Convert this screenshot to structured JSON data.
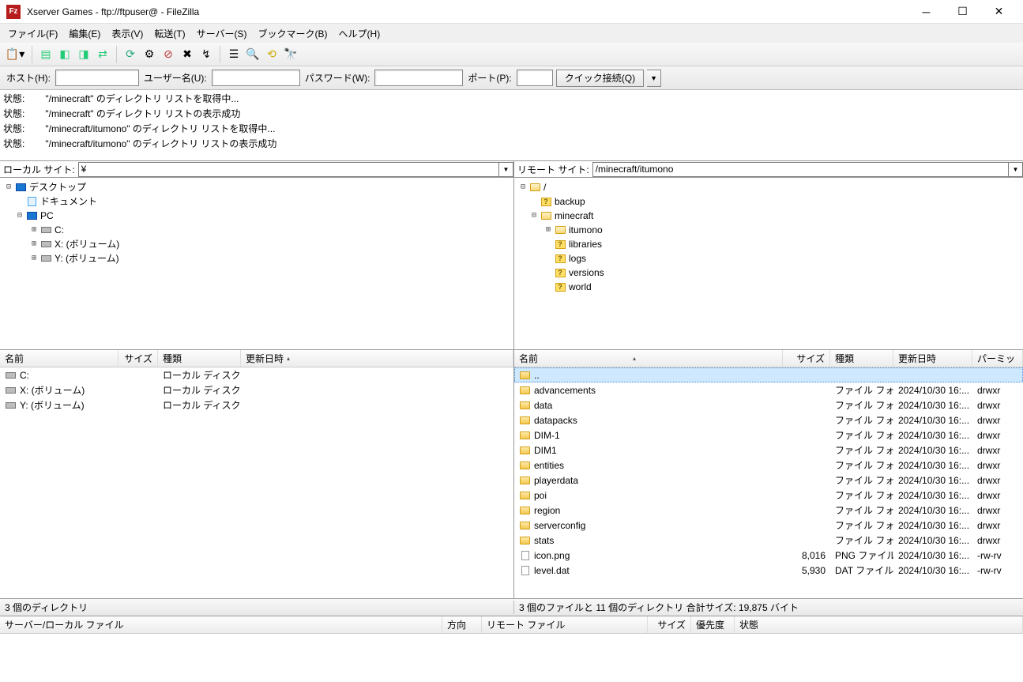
{
  "title": "Xserver Games - ftp://ftpuser@                        - FileZilla",
  "menus": {
    "file": "ファイル(F)",
    "edit": "編集(E)",
    "view": "表示(V)",
    "transfer": "転送(T)",
    "server": "サーバー(S)",
    "bookmarks": "ブックマーク(B)",
    "help": "ヘルプ(H)"
  },
  "quickbar": {
    "host_lbl": "ホスト(H):",
    "user_lbl": "ユーザー名(U):",
    "pass_lbl": "パスワード(W):",
    "port_lbl": "ポート(P):",
    "connect": "クイック接続(Q)"
  },
  "log": [
    {
      "label": "状態:",
      "text": "\"/minecraft\" のディレクトリ リストを取得中..."
    },
    {
      "label": "状態:",
      "text": "\"/minecraft\" のディレクトリ リストの表示成功"
    },
    {
      "label": "状態:",
      "text": "\"/minecraft/itumono\" のディレクトリ リストを取得中..."
    },
    {
      "label": "状態:",
      "text": "\"/minecraft/itumono\" のディレクトリ リストの表示成功"
    }
  ],
  "local_site_lbl": "ローカル サイト:",
  "local_site_val": "¥",
  "remote_site_lbl": "リモート サイト:",
  "remote_site_val": "/minecraft/itumono",
  "local_tree": {
    "desktop": "デスクトップ",
    "documents": "ドキュメント",
    "pc": "PC",
    "c": "C:",
    "x": "X: (ボリューム)",
    "y": "Y: (ボリューム)"
  },
  "remote_tree": {
    "root": "/",
    "backup": "backup",
    "minecraft": "minecraft",
    "itumono": "itumono",
    "libraries": "libraries",
    "logs": "logs",
    "versions": "versions",
    "world": "world"
  },
  "list_cols": {
    "name": "名前",
    "size": "サイズ",
    "type": "種類",
    "date": "更新日時",
    "perm": "パーミッ"
  },
  "local_list": [
    {
      "name": "C:",
      "type": "ローカル ディスク"
    },
    {
      "name": "X: (ボリューム)",
      "type": "ローカル ディスク"
    },
    {
      "name": "Y: (ボリューム)",
      "type": "ローカル ディスク"
    }
  ],
  "remote_list": [
    {
      "name": "..",
      "size": "",
      "type": "",
      "date": "",
      "perm": "",
      "icon": "folder"
    },
    {
      "name": "advancements",
      "size": "",
      "type": "ファイル フォ...",
      "date": "2024/10/30 16:...",
      "perm": "drwxr",
      "icon": "folder"
    },
    {
      "name": "data",
      "size": "",
      "type": "ファイル フォ...",
      "date": "2024/10/30 16:...",
      "perm": "drwxr",
      "icon": "folder"
    },
    {
      "name": "datapacks",
      "size": "",
      "type": "ファイル フォ...",
      "date": "2024/10/30 16:...",
      "perm": "drwxr",
      "icon": "folder"
    },
    {
      "name": "DIM-1",
      "size": "",
      "type": "ファイル フォ...",
      "date": "2024/10/30 16:...",
      "perm": "drwxr",
      "icon": "folder"
    },
    {
      "name": "DIM1",
      "size": "",
      "type": "ファイル フォ...",
      "date": "2024/10/30 16:...",
      "perm": "drwxr",
      "icon": "folder"
    },
    {
      "name": "entities",
      "size": "",
      "type": "ファイル フォ...",
      "date": "2024/10/30 16:...",
      "perm": "drwxr",
      "icon": "folder"
    },
    {
      "name": "playerdata",
      "size": "",
      "type": "ファイル フォ...",
      "date": "2024/10/30 16:...",
      "perm": "drwxr",
      "icon": "folder"
    },
    {
      "name": "poi",
      "size": "",
      "type": "ファイル フォ...",
      "date": "2024/10/30 16:...",
      "perm": "drwxr",
      "icon": "folder"
    },
    {
      "name": "region",
      "size": "",
      "type": "ファイル フォ...",
      "date": "2024/10/30 16:...",
      "perm": "drwxr",
      "icon": "folder"
    },
    {
      "name": "serverconfig",
      "size": "",
      "type": "ファイル フォ...",
      "date": "2024/10/30 16:...",
      "perm": "drwxr",
      "icon": "folder"
    },
    {
      "name": "stats",
      "size": "",
      "type": "ファイル フォ...",
      "date": "2024/10/30 16:...",
      "perm": "drwxr",
      "icon": "folder"
    },
    {
      "name": "icon.png",
      "size": "8,016",
      "type": "PNG ファイル",
      "date": "2024/10/30 16:...",
      "perm": "-rw-rv",
      "icon": "file"
    },
    {
      "name": "level.dat",
      "size": "5,930",
      "type": "DAT ファイル",
      "date": "2024/10/30 16:...",
      "perm": "-rw-rv",
      "icon": "file"
    }
  ],
  "local_status": "3 個のディレクトリ",
  "remote_status": "3 個のファイルと 11 個のディレクトリ  合計サイズ: 19,875 バイト",
  "queue_cols": {
    "server": "サーバー/ローカル ファイル",
    "dir": "方向",
    "remote": "リモート ファイル",
    "size": "サイズ",
    "prio": "優先度",
    "status": "状態"
  }
}
